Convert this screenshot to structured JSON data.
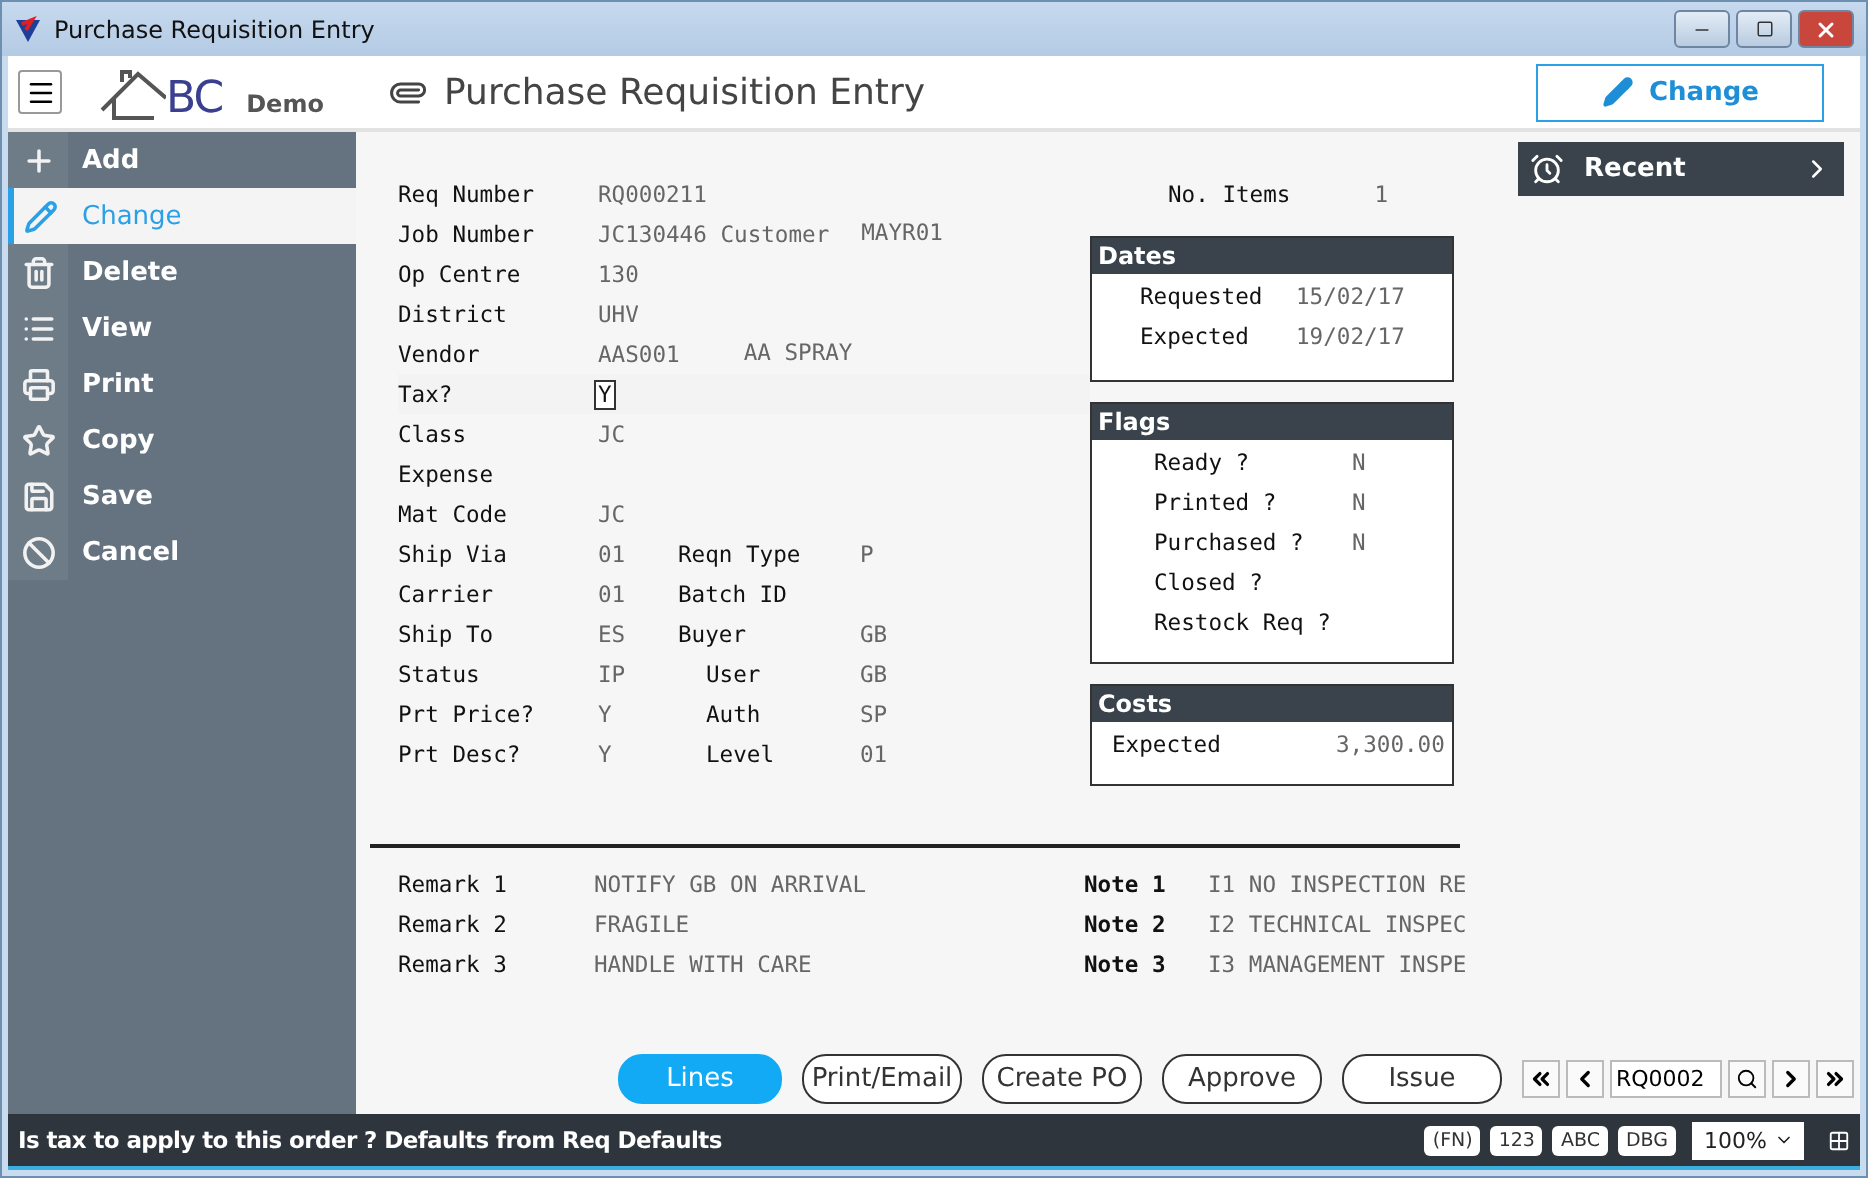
{
  "window": {
    "title": "Purchase Requisition Entry"
  },
  "header": {
    "logo_text": "BC",
    "logo_sub": "Demo",
    "page_title": "Purchase Requisition Entry",
    "mode_button": "Change"
  },
  "sidebar": {
    "items": [
      {
        "label": "Add",
        "selected": false
      },
      {
        "label": "Change",
        "selected": true
      },
      {
        "label": "Delete",
        "selected": false
      },
      {
        "label": "View",
        "selected": false
      },
      {
        "label": "Print",
        "selected": false
      },
      {
        "label": "Copy",
        "selected": false
      },
      {
        "label": "Save",
        "selected": false
      },
      {
        "label": "Cancel",
        "selected": false
      }
    ]
  },
  "form": {
    "rows": [
      {
        "label": "Req Number",
        "values": [
          "RQ000211"
        ],
        "focused": false
      },
      {
        "label": "Job Number",
        "values": [
          "JC130446 Customer",
          "MAYR01"
        ],
        "focused": false
      },
      {
        "label": "Op Centre",
        "values": [
          "130"
        ],
        "focused": false
      },
      {
        "label": "District",
        "values": [
          "UHV"
        ],
        "focused": false
      },
      {
        "label": "Vendor",
        "values": [
          "AAS001",
          "AA SPRAY"
        ],
        "focused": false
      },
      {
        "label": "Tax?",
        "values": [
          "Y"
        ],
        "focused": true
      },
      {
        "label": "Class",
        "values": [
          "JC"
        ],
        "focused": false
      },
      {
        "label": "Expense",
        "values": [],
        "focused": false
      },
      {
        "label": "Mat Code",
        "values": [
          "JC"
        ],
        "focused": false
      },
      {
        "label": "Ship Via",
        "values": [
          "01"
        ],
        "label2": "Reqn Type",
        "value2": "P",
        "focused": false
      },
      {
        "label": "Carrier",
        "values": [
          "01"
        ],
        "label2": "Batch ID",
        "focused": false
      },
      {
        "label": "Ship To",
        "values": [
          "ES"
        ],
        "label2": "Buyer",
        "value2": "GB",
        "focused": false
      },
      {
        "label": "Status",
        "values": [
          "IP"
        ],
        "label2": "User",
        "value2": "GB",
        "indent2": true,
        "focused": false
      },
      {
        "label": "Prt Price?",
        "values": [
          "Y"
        ],
        "label2": "Auth",
        "value2": "SP",
        "indent2": true,
        "focused": false
      },
      {
        "label": "Prt Desc?",
        "values": [
          "Y"
        ],
        "label2": "Level",
        "value2": "01",
        "indent2": true,
        "focused": false
      }
    ]
  },
  "items_count": {
    "label": "No. Items",
    "value": "1"
  },
  "panels": [
    {
      "title": "Dates",
      "kind": "dates",
      "rows": [
        {
          "label": "Requested",
          "value": "15/02/17"
        },
        {
          "label": "Expected",
          "value": "19/02/17"
        }
      ]
    },
    {
      "title": "Flags",
      "kind": "flags",
      "rows": [
        {
          "label": "Ready ?",
          "value": "N"
        },
        {
          "label": "Printed ?",
          "value": "N"
        },
        {
          "label": "Purchased ?",
          "value": "N"
        },
        {
          "label": "Closed ?"
        },
        {
          "label": "Restock Req ?"
        }
      ]
    },
    {
      "title": "Costs",
      "kind": "costs",
      "rows": [
        {
          "label": "Expected",
          "value": "3,300.00"
        }
      ]
    }
  ],
  "remarks": [
    {
      "label": "Remark 1",
      "value": "NOTIFY GB ON ARRIVAL",
      "note_label": "Note 1",
      "note_value": "I1 NO INSPECTION RE"
    },
    {
      "label": "Remark 2",
      "value": "FRAGILE",
      "note_label": "Note 2",
      "note_value": "I2 TECHNICAL INSPEC"
    },
    {
      "label": "Remark 3",
      "value": "HANDLE WITH CARE",
      "note_label": "Note 3",
      "note_value": "I3 MANAGEMENT INSPE"
    }
  ],
  "recent": {
    "label": "Recent"
  },
  "actions": [
    {
      "label": "Lines",
      "primary": true
    },
    {
      "label": "Print/Email",
      "primary": false
    },
    {
      "label": "Create PO",
      "primary": false
    },
    {
      "label": "Approve",
      "primary": false
    },
    {
      "label": "Issue",
      "primary": false
    }
  ],
  "navigator": {
    "value": "RQ0002"
  },
  "status_bar": {
    "message": "Is tax to apply to this order ? Defaults from Req Defaults",
    "badges": [
      "(FN)",
      "123",
      "ABC",
      "DBG"
    ],
    "zoom": "100%"
  }
}
